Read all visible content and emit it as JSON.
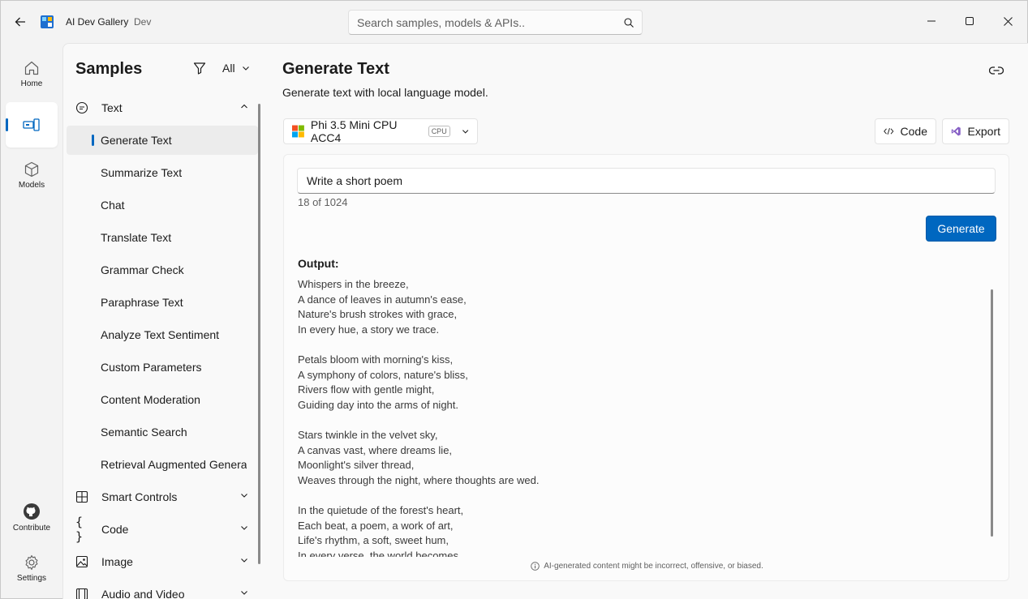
{
  "titlebar": {
    "app_name": "AI Dev Gallery",
    "badge": "Dev",
    "search_placeholder": "Search samples, models & APIs.."
  },
  "rail": {
    "items": [
      {
        "label": "Home",
        "icon": "home-icon"
      },
      {
        "label": "",
        "icon": "samples-icon"
      },
      {
        "label": "Models",
        "icon": "cube-icon"
      }
    ],
    "bottom": [
      {
        "label": "Contribute",
        "icon": "github-icon"
      },
      {
        "label": "Settings",
        "icon": "gear-icon"
      }
    ]
  },
  "samples": {
    "title": "Samples",
    "filter_label": "All",
    "groups": [
      {
        "label": "Text",
        "icon": "chat-bubble-icon",
        "expanded": true
      },
      {
        "label": "Smart Controls",
        "icon": "grid-icon"
      },
      {
        "label": "Code",
        "icon": "braces-icon"
      },
      {
        "label": "Image",
        "icon": "image-icon"
      },
      {
        "label": "Audio and Video",
        "icon": "film-icon"
      }
    ],
    "text_items": [
      "Generate Text",
      "Summarize Text",
      "Chat",
      "Translate Text",
      "Grammar Check",
      "Paraphrase Text",
      "Analyze Text Sentiment",
      "Custom Parameters",
      "Content Moderation",
      "Semantic Search",
      "Retrieval Augmented Generation"
    ]
  },
  "main": {
    "title": "Generate Text",
    "description": "Generate text with local language model.",
    "model_name": "Phi 3.5 Mini CPU ACC4",
    "model_badge": "CPU",
    "code_label": "Code",
    "export_label": "Export",
    "prompt_value": "Write a short poem",
    "char_count": "18 of 1024",
    "generate_label": "Generate",
    "output_label": "Output:",
    "output_stanzas": [
      [
        "Whispers in the breeze,",
        "A dance of leaves in autumn's ease,",
        "Nature's brush strokes with grace,",
        "In every hue, a story we trace."
      ],
      [
        "Petals bloom with morning's kiss,",
        "A symphony of colors, nature's bliss,",
        "Rivers flow with gentle might,",
        "Guiding day into the arms of night."
      ],
      [
        "Stars twinkle in the velvet sky,",
        "A canvas vast, where dreams lie,",
        "Moonlight's silver thread,",
        "Weaves through the night, where thoughts are wed."
      ],
      [
        "In the quietude of the forest's heart,",
        "Each beat, a poem, a work of art,",
        "Life's rhythm, a soft, sweet hum,",
        "In every verse, the world becomes"
      ]
    ],
    "disclaimer": "AI-generated content might be incorrect, offensive, or biased."
  },
  "colors": {
    "accent": "#0067c0",
    "window_bg": "#f3f3f3",
    "panel_bg": "#f9f9f9"
  }
}
